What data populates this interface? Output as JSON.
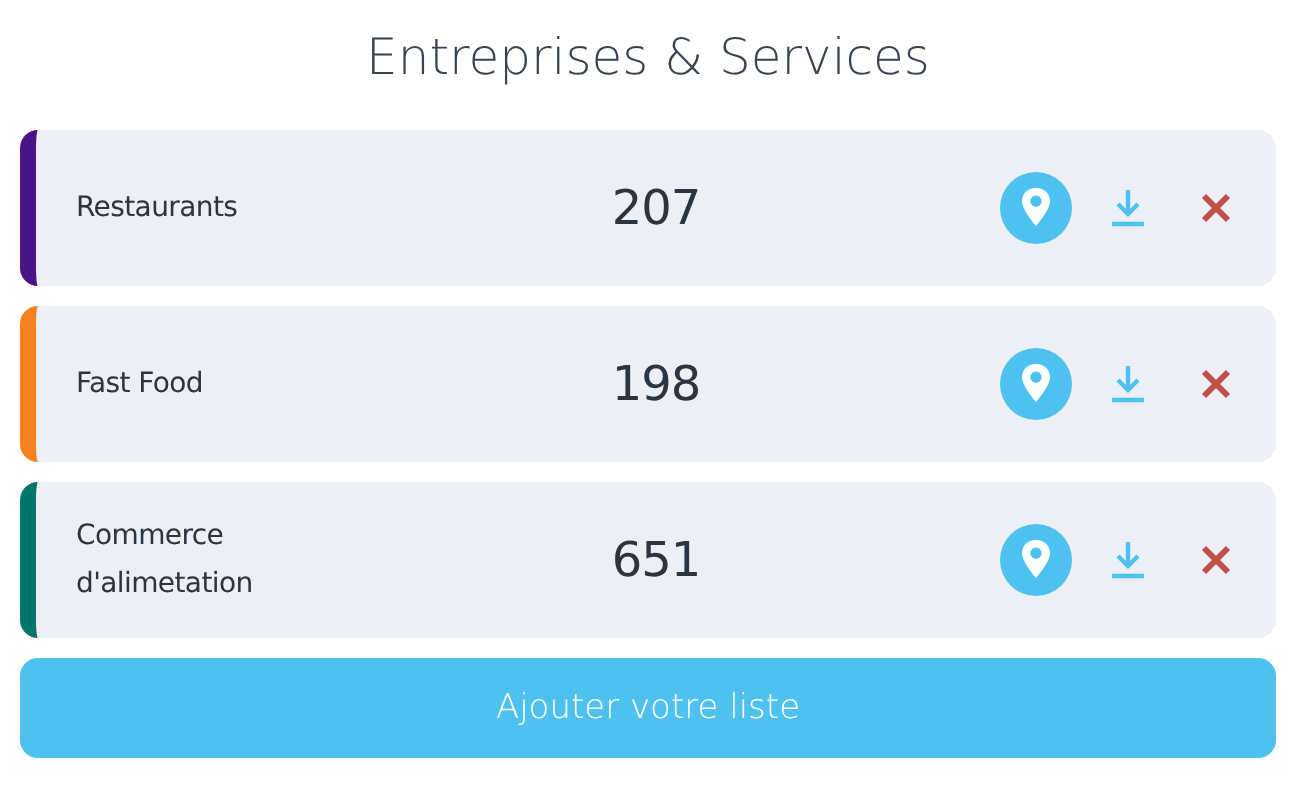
{
  "title": "Entreprises & Services",
  "items": [
    {
      "label": "Restaurants",
      "count": "207",
      "color": "#4a1486"
    },
    {
      "label": "Fast Food",
      "count": "198",
      "color": "#f5821f"
    },
    {
      "label": "Commerce d'alimetation",
      "count": "651",
      "color": "#00766a"
    }
  ],
  "add_button": "Ajouter votre liste"
}
